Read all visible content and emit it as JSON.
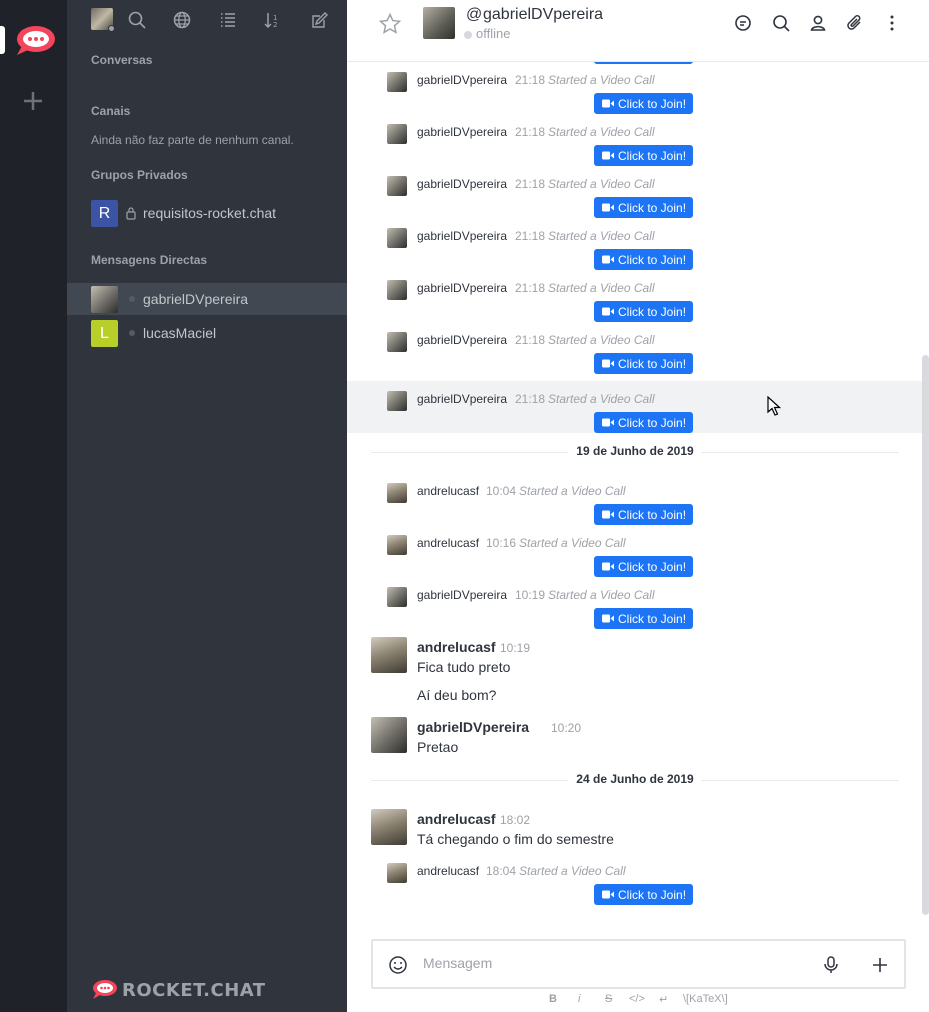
{
  "rail": {
    "server_icon": "rocket-chat-logo",
    "add_icon": "plus-icon"
  },
  "sidebar": {
    "icons": [
      "search-icon",
      "directory-icon",
      "view-mode-icon",
      "sort-icon",
      "create-new-icon"
    ],
    "sections": {
      "conversations": "Conversas",
      "channels": "Canais",
      "channels_empty": "Ainda não faz parte de nenhum canal.",
      "private_groups": "Grupos Privados",
      "direct_messages": "Mensagens Directas"
    },
    "private_group": {
      "initial": "R",
      "label": "requisitos-rocket.chat",
      "color": "#3d53a3"
    },
    "dms": [
      {
        "label": "gabrielDVpereira",
        "active": true
      },
      {
        "initial": "L",
        "label": "lucasMaciel",
        "color": "#b8cf2a"
      }
    ],
    "brand": "ROCKET.CHAT"
  },
  "header": {
    "at": "@",
    "room_name": "gabrielDVpereira",
    "status": "offline",
    "icons": [
      "star-icon",
      "discussion-icon",
      "search-messages-icon",
      "user-info-icon",
      "files-icon",
      "kebab-menu-icon"
    ]
  },
  "messages": {
    "video_calls_1": [
      {
        "user": "gabrielDVpereira",
        "time": "21:18",
        "text": "Started a Video Call",
        "button": "Click to Join!"
      },
      {
        "user": "gabrielDVpereira",
        "time": "21:18",
        "text": "Started a Video Call",
        "button": "Click to Join!"
      },
      {
        "user": "gabrielDVpereira",
        "time": "21:18",
        "text": "Started a Video Call",
        "button": "Click to Join!"
      },
      {
        "user": "gabrielDVpereira",
        "time": "21:18",
        "text": "Started a Video Call",
        "button": "Click to Join!"
      },
      {
        "user": "gabrielDVpereira",
        "time": "21:18",
        "text": "Started a Video Call",
        "button": "Click to Join!"
      },
      {
        "user": "gabrielDVpereira",
        "time": "21:18",
        "text": "Started a Video Call",
        "button": "Click to Join!"
      },
      {
        "user": "gabrielDVpereira",
        "time": "21:18",
        "text": "Started a Video Call",
        "button": "Click to Join!"
      }
    ],
    "date_1": "19 de Junho de 2019",
    "video_calls_2": [
      {
        "user": "andrelucasf",
        "time": "10:04",
        "text": "Started a Video Call",
        "button": "Click to Join!"
      },
      {
        "user": "andrelucasf",
        "time": "10:16",
        "text": "Started a Video Call",
        "button": "Click to Join!"
      },
      {
        "user": "gabrielDVpereira",
        "time": "10:19",
        "text": "Started a Video Call",
        "button": "Click to Join!"
      }
    ],
    "msg_1": {
      "user": "andrelucasf",
      "time": "10:19",
      "lines": [
        "Fica tudo preto",
        "Aí deu bom?"
      ]
    },
    "msg_2": {
      "user": "gabrielDVpereira",
      "time": "10:20",
      "lines": [
        "Pretao"
      ]
    },
    "date_2": "24 de Junho de 2019",
    "msg_3": {
      "user": "andrelucasf",
      "time": "18:02",
      "lines": [
        "Tá chegando o fim do semestre"
      ]
    },
    "video_call_3": {
      "user": "andrelucasf",
      "time": "18:04",
      "text": "Started a Video Call",
      "button": "Click to Join!"
    }
  },
  "composer": {
    "placeholder": "Mensagem",
    "format": {
      "bold": "B",
      "italic": "i",
      "strike": "S",
      "code": "</>",
      "enter": "↵",
      "katex": "\\[KaTeX\\]"
    }
  },
  "colors": {
    "rail_bg": "#1f2329",
    "sidebar_bg": "#2f343d",
    "accent": "#1d74f5",
    "brand_red": "#f5455c"
  }
}
